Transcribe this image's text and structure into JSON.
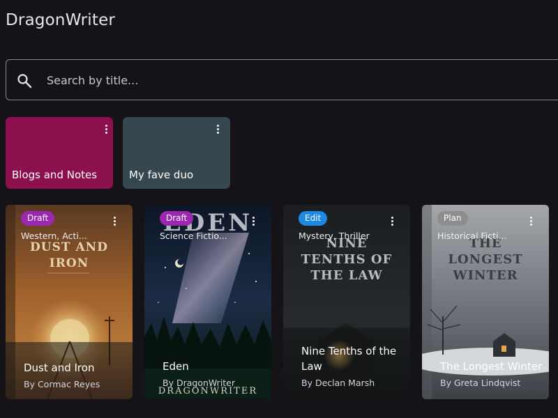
{
  "app": {
    "title": "DragonWriter"
  },
  "search": {
    "placeholder": "Search by title..."
  },
  "collections": [
    {
      "label": "Blogs and Notes",
      "color": "#8c0f4e"
    },
    {
      "label": "My fave duo",
      "color": "#37474f"
    }
  ],
  "books": [
    {
      "status": "Draft",
      "status_color": "#9c27b0",
      "genre": "Western, Acti...",
      "title": "Dust and Iron",
      "author": "By Cormac Reyes",
      "cover_text": "DUST AND IRON"
    },
    {
      "status": "Draft",
      "status_color": "#9c27b0",
      "genre": "Science Fictio...",
      "title": "Eden",
      "author": "By DragonWriter",
      "cover_text": "EDEN",
      "cover_footer": "DRAGONWRITER"
    },
    {
      "status": "Edit",
      "status_color": "#1e88e5",
      "genre": "Mystery, Thriller",
      "title": "Nine Tenths of the Law",
      "author": "By Declan Marsh",
      "cover_text": "NINE TENTHS OF THE LAW"
    },
    {
      "status": "Plan",
      "status_color": "#757575",
      "genre": "Historical Ficti...",
      "title": "The Longest Winter",
      "author": "By Greta Lindqvist",
      "cover_text": "THE LONGEST WINTER"
    }
  ]
}
